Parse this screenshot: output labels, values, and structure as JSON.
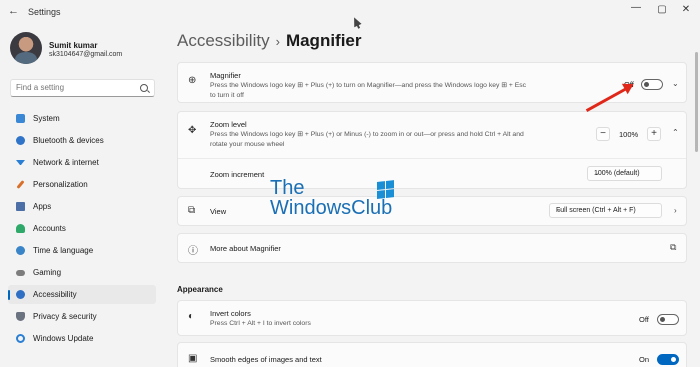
{
  "window": {
    "title": "Settings",
    "back_icon": "arrow-left-icon",
    "controls": [
      "minimize-icon",
      "maximize-icon",
      "close-icon"
    ]
  },
  "user": {
    "name": "Sumit kumar",
    "email": "sk3104647@gmail.com"
  },
  "search": {
    "placeholder": "Find a setting",
    "icon": "search-icon"
  },
  "sidebar": {
    "items": [
      {
        "label": "System",
        "icon": "monitor-icon",
        "color": "#3a87d6"
      },
      {
        "label": "Bluetooth & devices",
        "icon": "bluetooth-icon",
        "color": "#2f74c9"
      },
      {
        "label": "Network & internet",
        "icon": "wifi-icon",
        "color": "#2a7fd4"
      },
      {
        "label": "Personalization",
        "icon": "brush-icon",
        "color": "#d8702b"
      },
      {
        "label": "Apps",
        "icon": "apps-icon",
        "color": "#4b6fa6"
      },
      {
        "label": "Accounts",
        "icon": "person-icon",
        "color": "#2fa96a"
      },
      {
        "label": "Time & language",
        "icon": "globe-clock-icon",
        "color": "#3a84c8"
      },
      {
        "label": "Gaming",
        "icon": "gamepad-icon",
        "color": "#7d7d7d"
      },
      {
        "label": "Accessibility",
        "icon": "accessibility-icon",
        "color": "#2f6fc4"
      },
      {
        "label": "Privacy & security",
        "icon": "shield-icon",
        "color": "#6b7280"
      },
      {
        "label": "Windows Update",
        "icon": "sync-icon",
        "color": "#2a7fd4"
      }
    ],
    "active": "Accessibility"
  },
  "breadcrumb": {
    "parent": "Accessibility",
    "separator": "›",
    "current": "Magnifier"
  },
  "magnifier": {
    "icon": "magnifier-plus-icon",
    "title": "Magnifier",
    "desc_line1": "Press the Windows logo key ⊞ + Plus (+) to turn on Magnifier—and press the Windows logo key ⊞ + Esc",
    "desc_line2": "to turn it off",
    "state": "Off",
    "toggle_on": false
  },
  "zoom_level": {
    "icon": "zoom-move-icon",
    "title": "Zoom level",
    "desc_line1": "Press the Windows logo key ⊞ + Plus (+) or Minus (-) to zoom in or out—or press and hold Ctrl + Alt and",
    "desc_line2": "rotate your mouse wheel",
    "minus": "−",
    "value": "100%",
    "plus": "+"
  },
  "zoom_increment": {
    "title": "Zoom increment",
    "value": "100% (default)"
  },
  "view": {
    "icon": "view-icon",
    "title": "View",
    "value": "Full screen (Ctrl + Alt + F)"
  },
  "more_about": {
    "icon": "help-icon",
    "title": "More about Magnifier",
    "link_icon": "external-link-icon"
  },
  "appearance": {
    "section_title": "Appearance",
    "invert": {
      "icon": "invert-colors-icon",
      "title": "Invert colors",
      "desc": "Press Ctrl + Alt + I to invert colors",
      "state": "Off",
      "toggle_on": false
    },
    "smooth": {
      "icon": "image-icon",
      "title": "Smooth edges of images and text",
      "state": "On",
      "toggle_on": true
    }
  },
  "watermark": {
    "line1": "The",
    "line2": "WindowsClub"
  },
  "colors": {
    "accent": "#0067c0",
    "annotation_arrow": "#e0281a"
  }
}
